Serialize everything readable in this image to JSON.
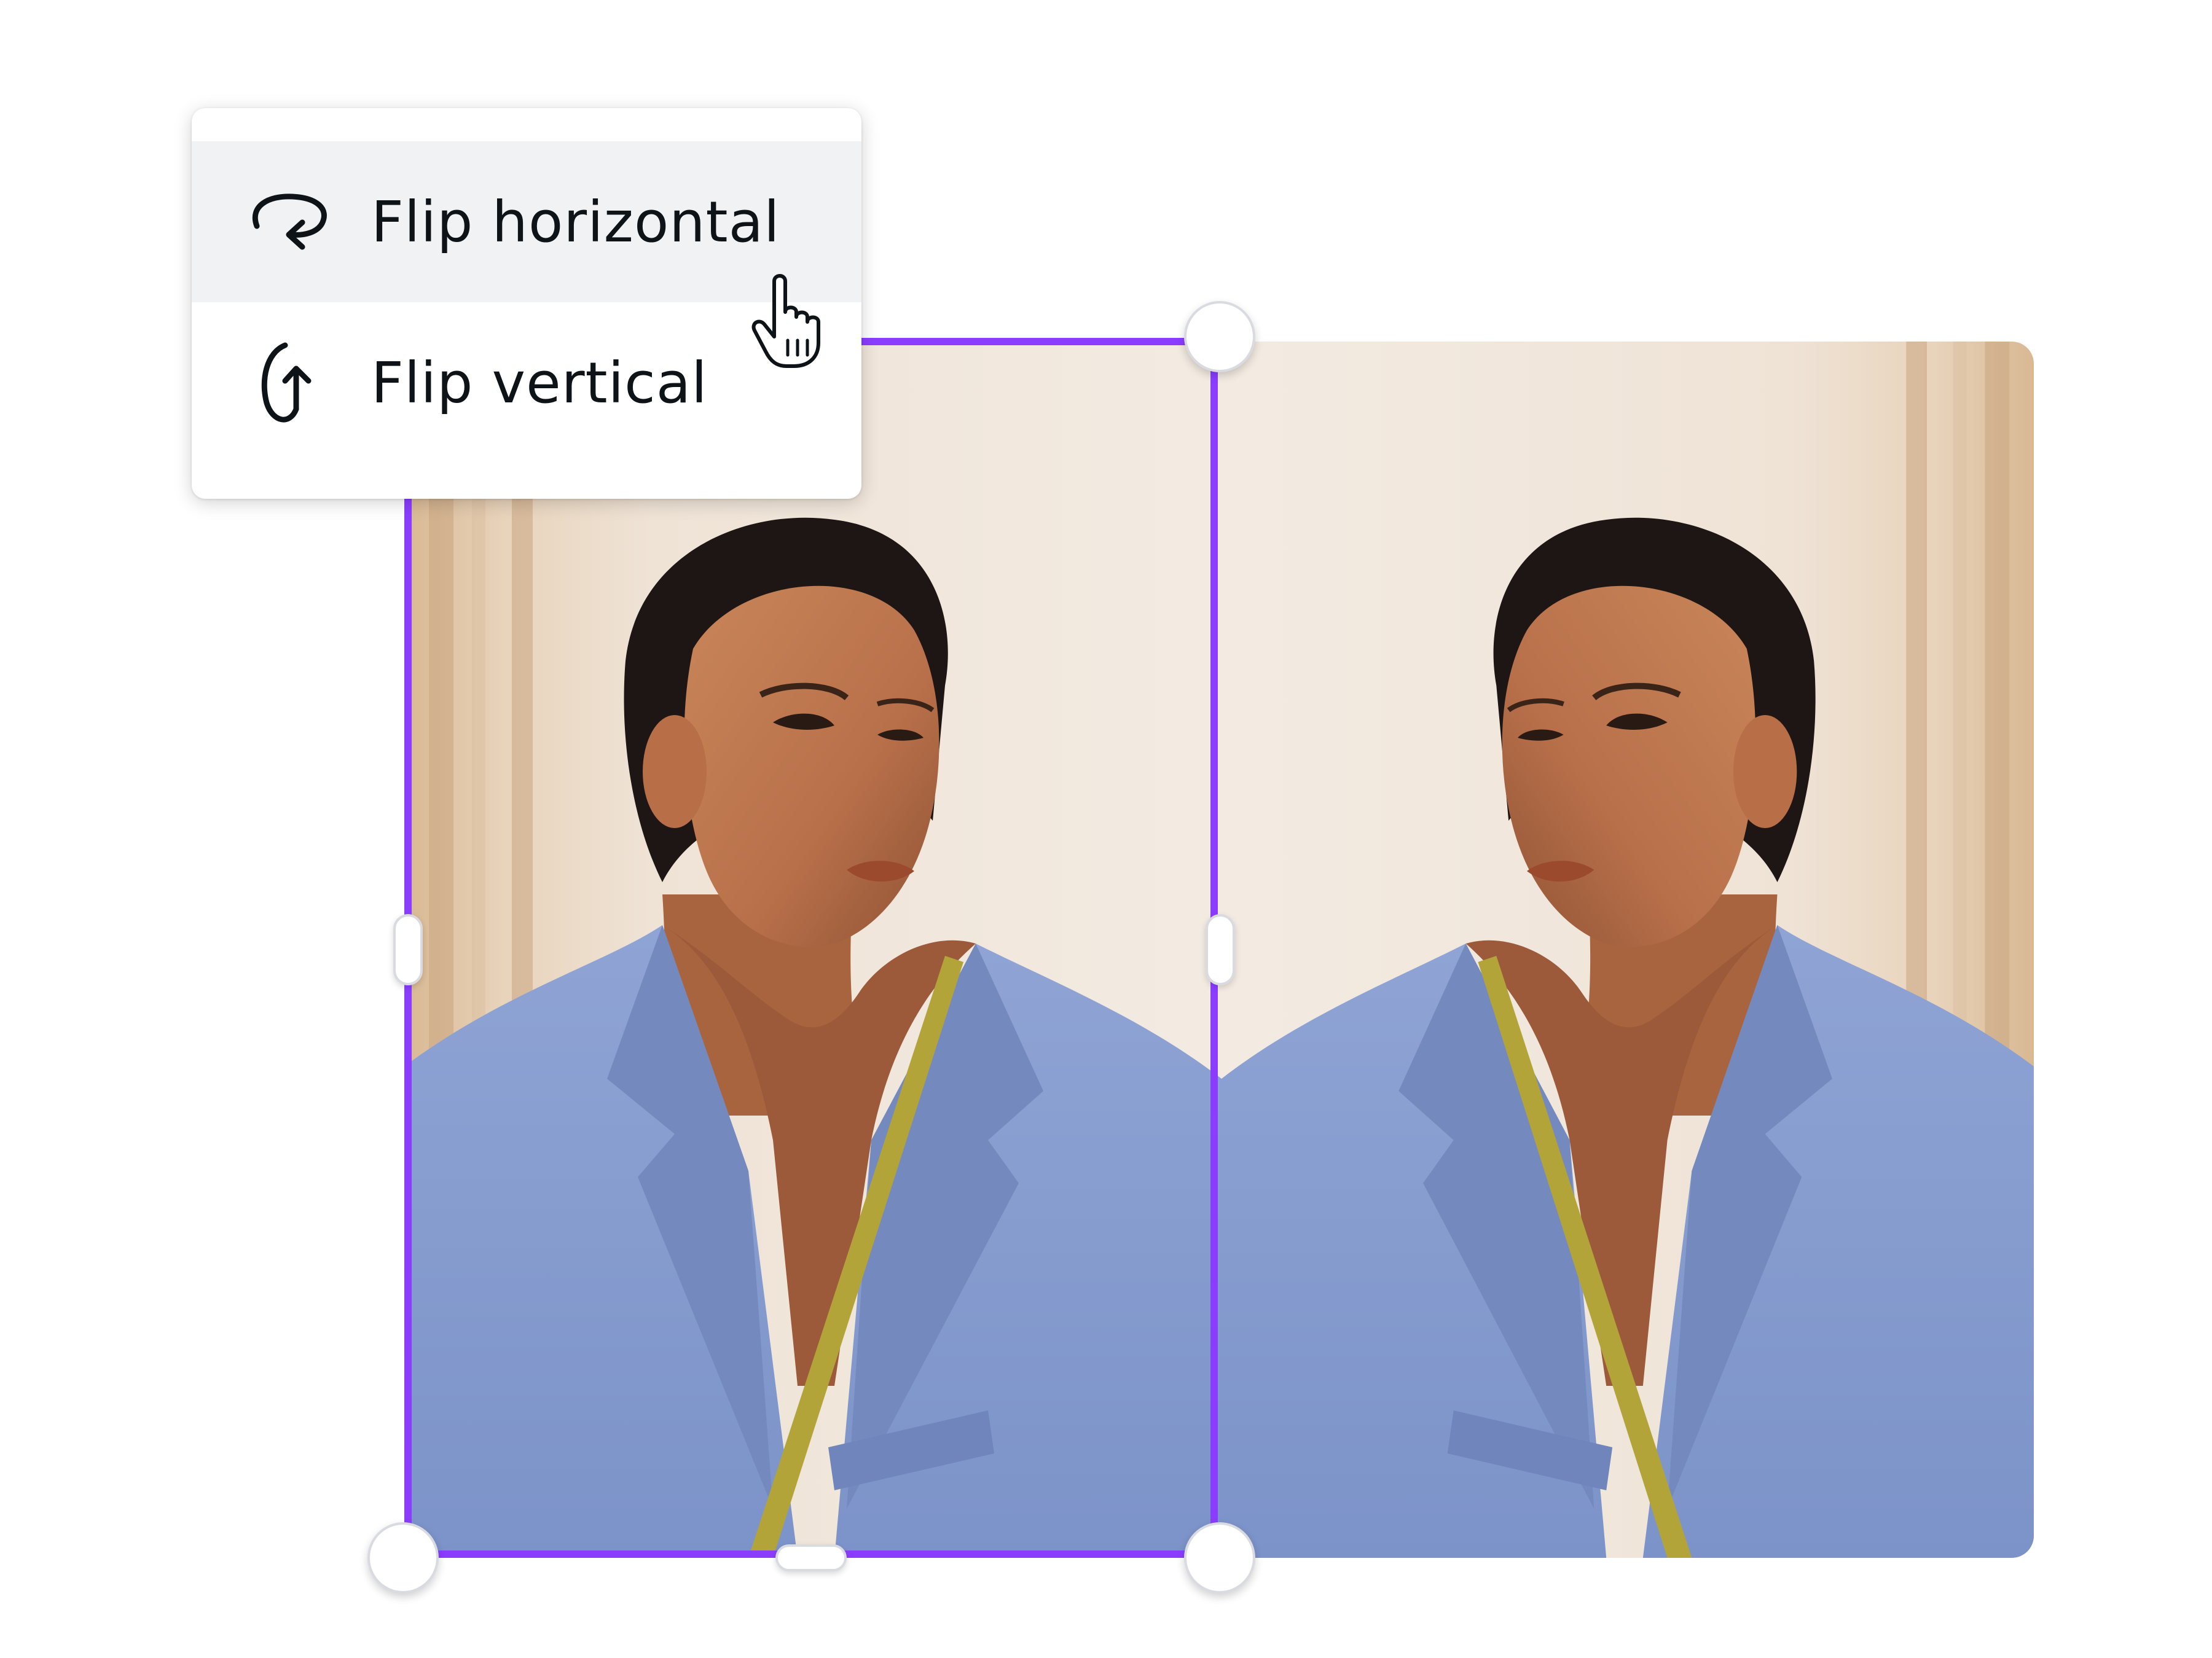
{
  "menu": {
    "items": [
      {
        "label": "Flip horizontal",
        "icon": "flip-horizontal-icon",
        "state": "hovered"
      },
      {
        "label": "Flip vertical",
        "icon": "flip-vertical-icon"
      }
    ]
  },
  "canvas": {
    "images": [
      {
        "name": "original-photo",
        "selected": true
      },
      {
        "name": "flipped-photo",
        "mirrored": true
      }
    ]
  },
  "colors": {
    "selection": "#8b3dff",
    "menu_hover": "#f1f2f4",
    "menu_text": "#0e1318"
  },
  "cursor": "pointer-hand-icon"
}
